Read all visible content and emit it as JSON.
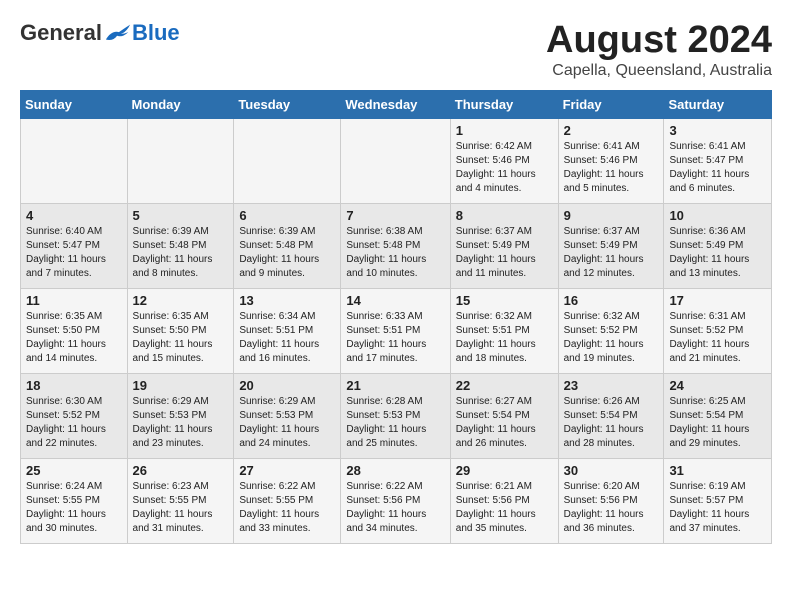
{
  "header": {
    "logo_general": "General",
    "logo_blue": "Blue",
    "month_title": "August 2024",
    "location": "Capella, Queensland, Australia"
  },
  "weekdays": [
    "Sunday",
    "Monday",
    "Tuesday",
    "Wednesday",
    "Thursday",
    "Friday",
    "Saturday"
  ],
  "weeks": [
    [
      {
        "day": "",
        "sunrise": "",
        "sunset": "",
        "daylight": ""
      },
      {
        "day": "",
        "sunrise": "",
        "sunset": "",
        "daylight": ""
      },
      {
        "day": "",
        "sunrise": "",
        "sunset": "",
        "daylight": ""
      },
      {
        "day": "",
        "sunrise": "",
        "sunset": "",
        "daylight": ""
      },
      {
        "day": "1",
        "sunrise": "Sunrise: 6:42 AM",
        "sunset": "Sunset: 5:46 PM",
        "daylight": "Daylight: 11 hours and 4 minutes."
      },
      {
        "day": "2",
        "sunrise": "Sunrise: 6:41 AM",
        "sunset": "Sunset: 5:46 PM",
        "daylight": "Daylight: 11 hours and 5 minutes."
      },
      {
        "day": "3",
        "sunrise": "Sunrise: 6:41 AM",
        "sunset": "Sunset: 5:47 PM",
        "daylight": "Daylight: 11 hours and 6 minutes."
      }
    ],
    [
      {
        "day": "4",
        "sunrise": "Sunrise: 6:40 AM",
        "sunset": "Sunset: 5:47 PM",
        "daylight": "Daylight: 11 hours and 7 minutes."
      },
      {
        "day": "5",
        "sunrise": "Sunrise: 6:39 AM",
        "sunset": "Sunset: 5:48 PM",
        "daylight": "Daylight: 11 hours and 8 minutes."
      },
      {
        "day": "6",
        "sunrise": "Sunrise: 6:39 AM",
        "sunset": "Sunset: 5:48 PM",
        "daylight": "Daylight: 11 hours and 9 minutes."
      },
      {
        "day": "7",
        "sunrise": "Sunrise: 6:38 AM",
        "sunset": "Sunset: 5:48 PM",
        "daylight": "Daylight: 11 hours and 10 minutes."
      },
      {
        "day": "8",
        "sunrise": "Sunrise: 6:37 AM",
        "sunset": "Sunset: 5:49 PM",
        "daylight": "Daylight: 11 hours and 11 minutes."
      },
      {
        "day": "9",
        "sunrise": "Sunrise: 6:37 AM",
        "sunset": "Sunset: 5:49 PM",
        "daylight": "Daylight: 11 hours and 12 minutes."
      },
      {
        "day": "10",
        "sunrise": "Sunrise: 6:36 AM",
        "sunset": "Sunset: 5:49 PM",
        "daylight": "Daylight: 11 hours and 13 minutes."
      }
    ],
    [
      {
        "day": "11",
        "sunrise": "Sunrise: 6:35 AM",
        "sunset": "Sunset: 5:50 PM",
        "daylight": "Daylight: 11 hours and 14 minutes."
      },
      {
        "day": "12",
        "sunrise": "Sunrise: 6:35 AM",
        "sunset": "Sunset: 5:50 PM",
        "daylight": "Daylight: 11 hours and 15 minutes."
      },
      {
        "day": "13",
        "sunrise": "Sunrise: 6:34 AM",
        "sunset": "Sunset: 5:51 PM",
        "daylight": "Daylight: 11 hours and 16 minutes."
      },
      {
        "day": "14",
        "sunrise": "Sunrise: 6:33 AM",
        "sunset": "Sunset: 5:51 PM",
        "daylight": "Daylight: 11 hours and 17 minutes."
      },
      {
        "day": "15",
        "sunrise": "Sunrise: 6:32 AM",
        "sunset": "Sunset: 5:51 PM",
        "daylight": "Daylight: 11 hours and 18 minutes."
      },
      {
        "day": "16",
        "sunrise": "Sunrise: 6:32 AM",
        "sunset": "Sunset: 5:52 PM",
        "daylight": "Daylight: 11 hours and 19 minutes."
      },
      {
        "day": "17",
        "sunrise": "Sunrise: 6:31 AM",
        "sunset": "Sunset: 5:52 PM",
        "daylight": "Daylight: 11 hours and 21 minutes."
      }
    ],
    [
      {
        "day": "18",
        "sunrise": "Sunrise: 6:30 AM",
        "sunset": "Sunset: 5:52 PM",
        "daylight": "Daylight: 11 hours and 22 minutes."
      },
      {
        "day": "19",
        "sunrise": "Sunrise: 6:29 AM",
        "sunset": "Sunset: 5:53 PM",
        "daylight": "Daylight: 11 hours and 23 minutes."
      },
      {
        "day": "20",
        "sunrise": "Sunrise: 6:29 AM",
        "sunset": "Sunset: 5:53 PM",
        "daylight": "Daylight: 11 hours and 24 minutes."
      },
      {
        "day": "21",
        "sunrise": "Sunrise: 6:28 AM",
        "sunset": "Sunset: 5:53 PM",
        "daylight": "Daylight: 11 hours and 25 minutes."
      },
      {
        "day": "22",
        "sunrise": "Sunrise: 6:27 AM",
        "sunset": "Sunset: 5:54 PM",
        "daylight": "Daylight: 11 hours and 26 minutes."
      },
      {
        "day": "23",
        "sunrise": "Sunrise: 6:26 AM",
        "sunset": "Sunset: 5:54 PM",
        "daylight": "Daylight: 11 hours and 28 minutes."
      },
      {
        "day": "24",
        "sunrise": "Sunrise: 6:25 AM",
        "sunset": "Sunset: 5:54 PM",
        "daylight": "Daylight: 11 hours and 29 minutes."
      }
    ],
    [
      {
        "day": "25",
        "sunrise": "Sunrise: 6:24 AM",
        "sunset": "Sunset: 5:55 PM",
        "daylight": "Daylight: 11 hours and 30 minutes."
      },
      {
        "day": "26",
        "sunrise": "Sunrise: 6:23 AM",
        "sunset": "Sunset: 5:55 PM",
        "daylight": "Daylight: 11 hours and 31 minutes."
      },
      {
        "day": "27",
        "sunrise": "Sunrise: 6:22 AM",
        "sunset": "Sunset: 5:55 PM",
        "daylight": "Daylight: 11 hours and 33 minutes."
      },
      {
        "day": "28",
        "sunrise": "Sunrise: 6:22 AM",
        "sunset": "Sunset: 5:56 PM",
        "daylight": "Daylight: 11 hours and 34 minutes."
      },
      {
        "day": "29",
        "sunrise": "Sunrise: 6:21 AM",
        "sunset": "Sunset: 5:56 PM",
        "daylight": "Daylight: 11 hours and 35 minutes."
      },
      {
        "day": "30",
        "sunrise": "Sunrise: 6:20 AM",
        "sunset": "Sunset: 5:56 PM",
        "daylight": "Daylight: 11 hours and 36 minutes."
      },
      {
        "day": "31",
        "sunrise": "Sunrise: 6:19 AM",
        "sunset": "Sunset: 5:57 PM",
        "daylight": "Daylight: 11 hours and 37 minutes."
      }
    ]
  ]
}
